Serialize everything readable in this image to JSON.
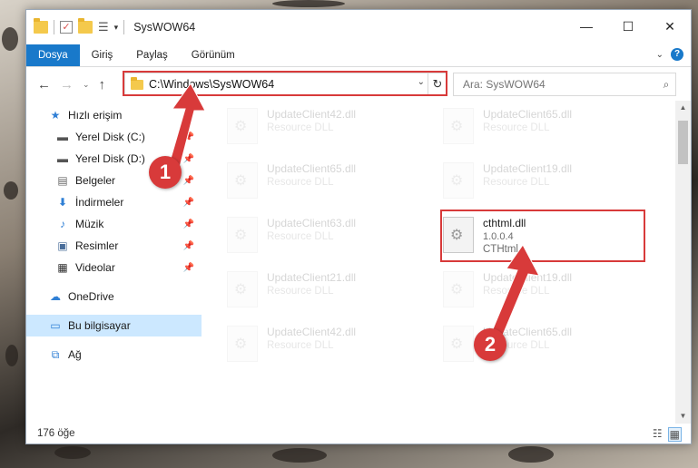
{
  "window": {
    "title": "SysWOW64",
    "controls": {
      "minimize": "—",
      "maximize": "☐",
      "close": "✕"
    }
  },
  "ribbon": {
    "tabs": [
      "Dosya",
      "Giriş",
      "Paylaş",
      "Görünüm"
    ],
    "active_tab": "Dosya"
  },
  "address": {
    "path": "C:\\Windows\\SysWOW64"
  },
  "search": {
    "placeholder": "Ara: SysWOW64"
  },
  "sidebar": {
    "quick_access": "Hızlı erişim",
    "items": [
      {
        "label": "Yerel Disk (C:)",
        "icon": "drive-icon"
      },
      {
        "label": "Yerel Disk (D:)",
        "icon": "drive-icon"
      },
      {
        "label": "Belgeler",
        "icon": "document-icon"
      },
      {
        "label": "İndirmeler",
        "icon": "download-icon"
      },
      {
        "label": "Müzik",
        "icon": "music-icon"
      },
      {
        "label": "Resimler",
        "icon": "pictures-icon"
      },
      {
        "label": "Videolar",
        "icon": "video-icon"
      }
    ],
    "onedrive": "OneDrive",
    "this_pc": "Bu bilgisayar",
    "network": "Ağ"
  },
  "files": [
    {
      "name": "UpdateClient42.dll",
      "desc": "Resource DLL",
      "faded": true
    },
    {
      "name": "UpdateClient65.dll",
      "desc": "Resource DLL",
      "faded": true
    },
    {
      "name": "UpdateClient65.dll",
      "desc": "Resource DLL",
      "faded": true
    },
    {
      "name": "UpdateClient19.dll",
      "desc": "Resource DLL",
      "faded": true
    },
    {
      "name": "UpdateClient63.dll",
      "desc": "Resource DLL",
      "faded": true
    },
    {
      "name": "cthtml.dll",
      "version": "1.0.0.4",
      "desc": "CTHtml",
      "faded": false
    },
    {
      "name": "UpdateClient21.dll",
      "desc": "Resource DLL",
      "faded": true
    },
    {
      "name": "UpdateClient19.dll",
      "desc": "Resource DLL",
      "faded": true
    },
    {
      "name": "UpdateClient42.dll",
      "desc": "Resource DLL",
      "faded": true
    },
    {
      "name": "UpdateClient65.dll",
      "desc": "Resource DLL",
      "faded": true
    }
  ],
  "status": {
    "count": "176 öğe"
  },
  "callouts": {
    "one": "1",
    "two": "2"
  },
  "colors": {
    "accent": "#1979ca",
    "highlight": "#d83a3a"
  }
}
